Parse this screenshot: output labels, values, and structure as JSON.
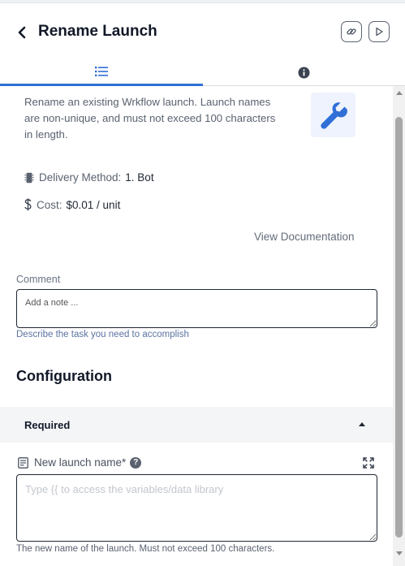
{
  "header": {
    "title": "Rename Launch"
  },
  "tabs": [
    {
      "icon": "list-icon",
      "active": true
    },
    {
      "icon": "info-icon",
      "active": false
    }
  ],
  "details": {
    "description": "Rename an existing Wrkflow launch. Launch names are non-unique, and must not exceed 100 characters in length.",
    "delivery_label": "Delivery Method:",
    "delivery_value": "1. Bot",
    "cost_label": "Cost:",
    "cost_value": "$0.01 / unit",
    "doc_link": "View Documentation"
  },
  "comment": {
    "label": "Comment",
    "placeholder": "Add a note ...",
    "value": "",
    "help": "Describe the task you need to accomplish"
  },
  "configuration": {
    "title": "Configuration",
    "section_label": "Required",
    "field": {
      "label": "New launch name*",
      "placeholder": "Type {{ to access the variables/data library",
      "value": "",
      "help": "The new name of the launch. Must not exceed 100 characters."
    }
  },
  "colors": {
    "accent": "#2f6fd6",
    "tool_icon_bg": "#eef3fd"
  }
}
